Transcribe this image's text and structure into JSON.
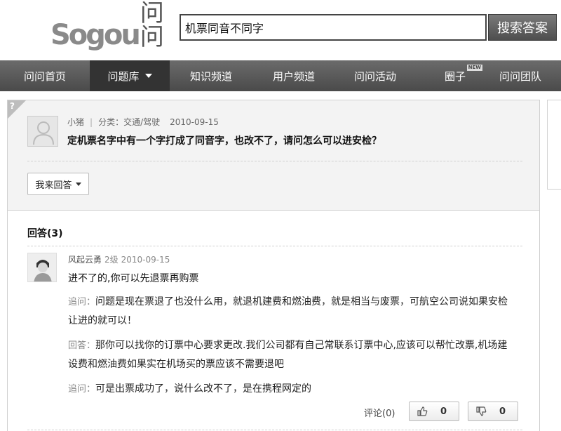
{
  "header": {
    "logo_sogou": "Sogou",
    "logo_wenwen": "问问",
    "search_value": "机票同音不同字",
    "search_button": "搜索答案"
  },
  "nav": {
    "items": [
      {
        "label": "问问首页",
        "active": false
      },
      {
        "label": "问题库",
        "active": true,
        "dropdown": true
      },
      {
        "label": "知识频道",
        "active": false
      },
      {
        "label": "用户频道",
        "active": false
      },
      {
        "label": "问问活动",
        "active": false
      },
      {
        "label": "圈子",
        "active": false,
        "badge": "NEW"
      },
      {
        "label": "问问团队",
        "active": false
      }
    ]
  },
  "question": {
    "corner_mark": "?",
    "author": "小猪",
    "category": "分类：交通/驾驶",
    "date": "2010-09-15",
    "title": "定机票名字中有一个字打成了同音字，也改不了，请问怎么可以进安检？",
    "answer_button": "我来回答"
  },
  "answers": {
    "heading": "回答(3)",
    "first": {
      "author": "风起云勇",
      "level": "2级",
      "date": "2010-09-15",
      "text": "进不了的,你可以先退票再购票",
      "followups": [
        {
          "label": "追问：",
          "text": "问题是现在票退了也没什么用，就退机建费和燃油费，就是相当与废票，可航空公司说如果安检让进的就可以！"
        },
        {
          "label": "回答：",
          "text": "那你可以找你的订票中心要求更改.我们公司都有自己常联系订票中心,应该可以帮忙改票,机场建设费和燃油费如果实在机场买的票应该不需要退吧"
        },
        {
          "label": "追问：",
          "text": "可是出票成功了，说什么改不了，是在携程网定的"
        }
      ],
      "comment": "评论(0)",
      "upvotes": "0",
      "downvotes": "0"
    }
  }
}
